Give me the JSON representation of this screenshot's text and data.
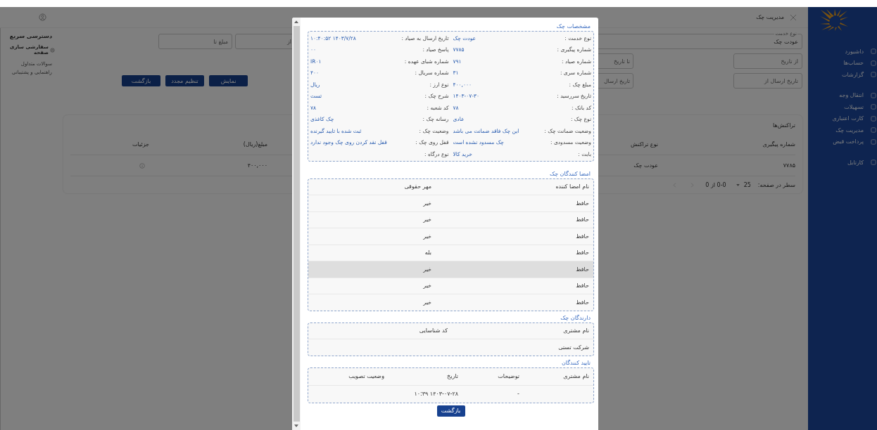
{
  "header": {
    "title": "مدیریت چک"
  },
  "sidebar": {
    "groups": [
      [
        {
          "label": "داشبورد"
        },
        {
          "label": "حساب‌ها"
        },
        {
          "label": "گزارشات"
        }
      ],
      [
        {
          "label": "انتقال وجه"
        },
        {
          "label": "تسهیلات"
        },
        {
          "label": "کارت اعتباری"
        },
        {
          "label": "مدیریت چک"
        },
        {
          "label": "پرداخت قبض"
        }
      ],
      [
        {
          "label": "کارتابل"
        }
      ]
    ]
  },
  "quick_access": {
    "title": "دسترسی سریع",
    "customize": "سفارشی سازی صفحه",
    "links": [
      "سوالات متداول",
      "راهنمایی و پشتیبانی"
    ]
  },
  "filters": {
    "service_type": {
      "label": "نوع خدمت",
      "value": "عودت چک"
    },
    "amount_from": {
      "placeholder": "از"
    },
    "amount_to": {
      "placeholder": "مبلغ تا"
    },
    "date_from": {
      "placeholder": "از تاریخ"
    },
    "date_to": {
      "placeholder": "تا تاریخ"
    },
    "send_date_from": {
      "placeholder": "تاریخ ارسال از"
    },
    "send_date_to": {
      "placeholder": "تاریخ ارسال"
    }
  },
  "buttons": [
    "نمایش",
    "تنظیم مجدد",
    "بازگشت"
  ],
  "transactions": {
    "title": "تراکنش‌ها",
    "columns": [
      "شماره پیگیری",
      "نوع تراکنش",
      "مبلغ(ریال)",
      "جزئیات"
    ],
    "rows": [
      {
        "tracking": "۷۷۸۵",
        "type": "عودت چک",
        "amount": "۴۰۰,۰۰۰"
      }
    ],
    "rows_per_page_label": "سطر در صفحه:",
    "rows_per_page": "25",
    "range": "0-0 از 0"
  },
  "modal": {
    "title": "مشخصات چک",
    "details": [
      {
        "label": "نوع خدمت :",
        "value": "عودت چک"
      },
      {
        "label": "تاریخ ارسال به صیاد :",
        "value": "۱۴۰۳/۷/۲۸ ۱۰:۴۰:۵۲"
      },
      {
        "label": "شماره پیگیری :",
        "value": "۷۷۸۵"
      },
      {
        "label": "پاسخ صیاد :",
        "value": "۰۰"
      },
      {
        "label": "شماره صیاد :",
        "value": "۷۹۱"
      },
      {
        "label": "شماره شبای عهده :",
        "value": "IR۰۱"
      },
      {
        "label": "شماره سری :",
        "value": "۳۱"
      },
      {
        "label": "شماره سریال :",
        "value": "۴۰۰"
      },
      {
        "label": "مبلغ چک :",
        "value": "۴۰۰,۰۰۰"
      },
      {
        "label": "نوع ارز :",
        "value": "ریال"
      },
      {
        "label": "تاریخ سررسید :",
        "value": "۱۴۰۳-۰۷-۳۰"
      },
      {
        "label": "شرح چک :",
        "value": "تست"
      },
      {
        "label": "کد بانک :",
        "value": "۷۸"
      },
      {
        "label": "کد شعبه :",
        "value": "۷۸"
      },
      {
        "label": "نوع چک :",
        "value": "عادی"
      },
      {
        "label": "رسانه چک :",
        "value": "چک کاغذی"
      },
      {
        "label": "وضعیت ضمانت چک :",
        "value": "این چک فاقد ضمانت می باشد"
      },
      {
        "label": "وضعیت چک :",
        "value": "ثبت شده با تایید گیرنده"
      },
      {
        "label": "وضعیت مسدودی :",
        "value": "چک مسدود نشده است"
      },
      {
        "label": "قفل روی چک :",
        "value": "قفل نقد کردن روی چک وجود ندارد"
      },
      {
        "label": "بابت :",
        "value": "خرید کالا"
      },
      {
        "label": "نوع درگاه :"
      }
    ],
    "signers": {
      "title": "امضا کنندگان چک",
      "columns": [
        "نام امضا کننده",
        "مهر حقوقی"
      ],
      "rows": [
        {
          "name": "حافظ",
          "seal": "خیر",
          "selected": false
        },
        {
          "name": "حافظ",
          "seal": "خیر",
          "selected": false
        },
        {
          "name": "حافظ",
          "seal": "خیر",
          "selected": false
        },
        {
          "name": "حافظ",
          "seal": "بله",
          "selected": false
        },
        {
          "name": "حافظ",
          "seal": "خیر",
          "selected": true
        },
        {
          "name": "حافظ",
          "seal": "خیر",
          "selected": false
        },
        {
          "name": "حافظ",
          "seal": "خیر",
          "selected": false
        }
      ]
    },
    "holders": {
      "title": "دارندگان چک",
      "columns": [
        "نام مشتری",
        "کد شناسایی"
      ],
      "rows": [
        {
          "name": "شرکت تستی"
        }
      ]
    },
    "approvers": {
      "title": "تایید کنندگان",
      "columns": [
        "نام مشتری",
        "توضیحات",
        "تاریخ",
        "وضعیت تصویب"
      ],
      "rows": [
        {
          "comment": "-",
          "date": "۱۴۰۳-۰۷-۲۸ ۱۰:۳۹"
        }
      ]
    },
    "back_button": "بازگشت"
  }
}
